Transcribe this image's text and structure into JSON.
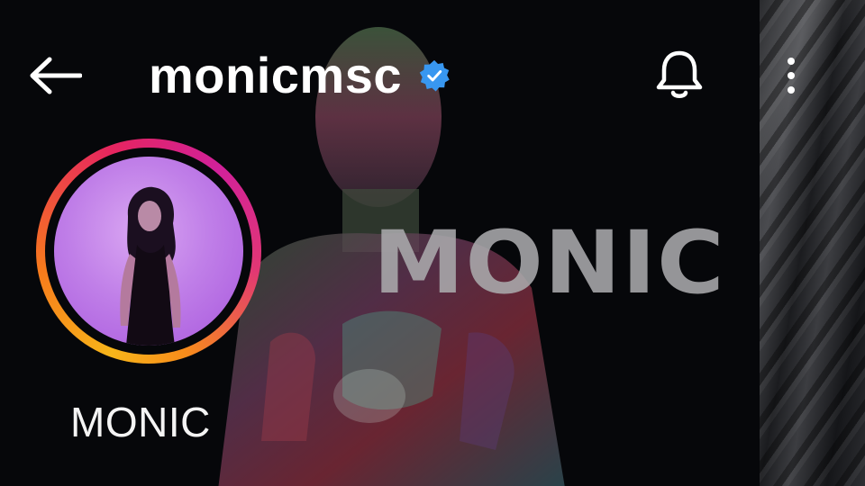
{
  "header": {
    "back_icon": "arrow-left-icon",
    "username": "monicmsc",
    "verified_icon": "verified-badge-icon",
    "bell_icon": "bell-icon",
    "more_icon": "more-vertical-icon"
  },
  "profile": {
    "display_name": "MONIC",
    "story_ring": true
  },
  "background": {
    "logo_text": "MONIC"
  },
  "colors": {
    "verified_blue": "#3897f0",
    "ring_gradient": [
      "#f7b51a",
      "#f77a1c",
      "#e6255f",
      "#d1219a"
    ],
    "avatar_backdrop": "#c07fe8"
  }
}
